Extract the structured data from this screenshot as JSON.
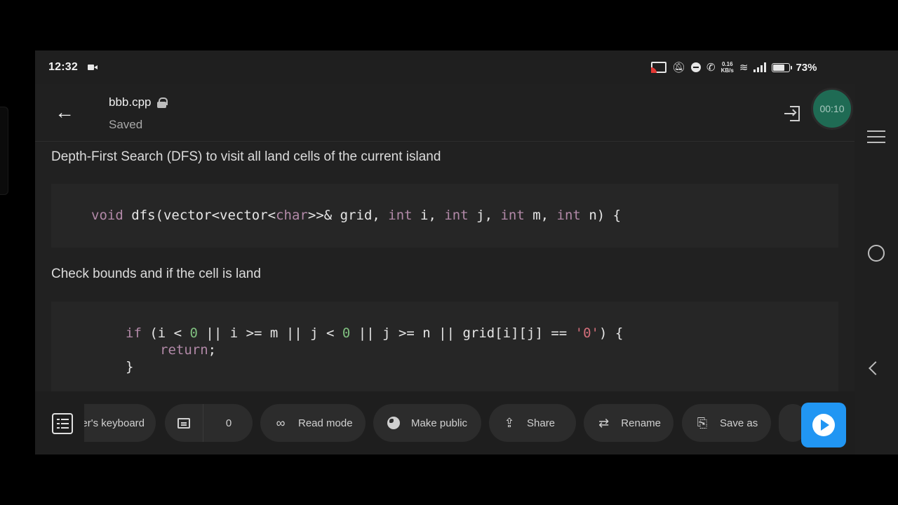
{
  "status_bar": {
    "time": "12:32",
    "net_speed_value": "0.16",
    "net_speed_unit": "KB/s",
    "battery": "73%",
    "battery_level": 0.73
  },
  "app_bar": {
    "file_name": "bbb.cpp",
    "save_status": "Saved",
    "timer": "00:10"
  },
  "content": {
    "paragraph_1": "Depth-First Search (DFS) to visit all land cells of the current island",
    "paragraph_2": "Check bounds and if the cell is land",
    "code_1": {
      "kw_void": "void",
      "t1": " dfs(vector<vector<",
      "kw_char": "char",
      "t2": ">>& grid, ",
      "kw_int1": "int",
      "t3": " i, ",
      "kw_int2": "int",
      "t4": " j, ",
      "kw_int3": "int",
      "t5": " m, ",
      "kw_int4": "int",
      "t6": " n) {"
    },
    "code_2": {
      "kw_if": "if",
      "t1": " (i < ",
      "n1": "0",
      "t2": " || i >= m || j < ",
      "n2": "0",
      "t3": " || j >= n || grid[i][j] == ",
      "s1": "'0'",
      "t4": ") {",
      "kw_return": "return",
      "t5": ";",
      "close": "}"
    }
  },
  "toolbar": {
    "keyboard_label": "er's keyboard",
    "comment_count": "0",
    "read_mode": "Read mode",
    "make_public": "Make public",
    "share": "Share",
    "rename": "Rename",
    "save_as": "Save as"
  },
  "colors": {
    "keyword": "#b289a8",
    "number": "#7fbf7f",
    "string": "#d36e7a",
    "accent": "#2196f3",
    "timer": "#1f6b54"
  }
}
